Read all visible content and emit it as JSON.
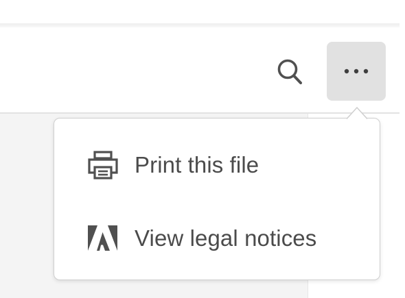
{
  "toolbar": {
    "search_icon": "search-icon",
    "more_icon": "more-horizontal-icon"
  },
  "menu": {
    "items": [
      {
        "label": "Print this file",
        "icon": "printer-icon"
      },
      {
        "label": "View legal notices",
        "icon": "adobe-logo-icon"
      }
    ]
  },
  "colors": {
    "menu_text": "#4b4b4b",
    "icon": "#505050",
    "button_active_bg": "#e1e1e1",
    "menu_border": "#cfcfcf"
  }
}
